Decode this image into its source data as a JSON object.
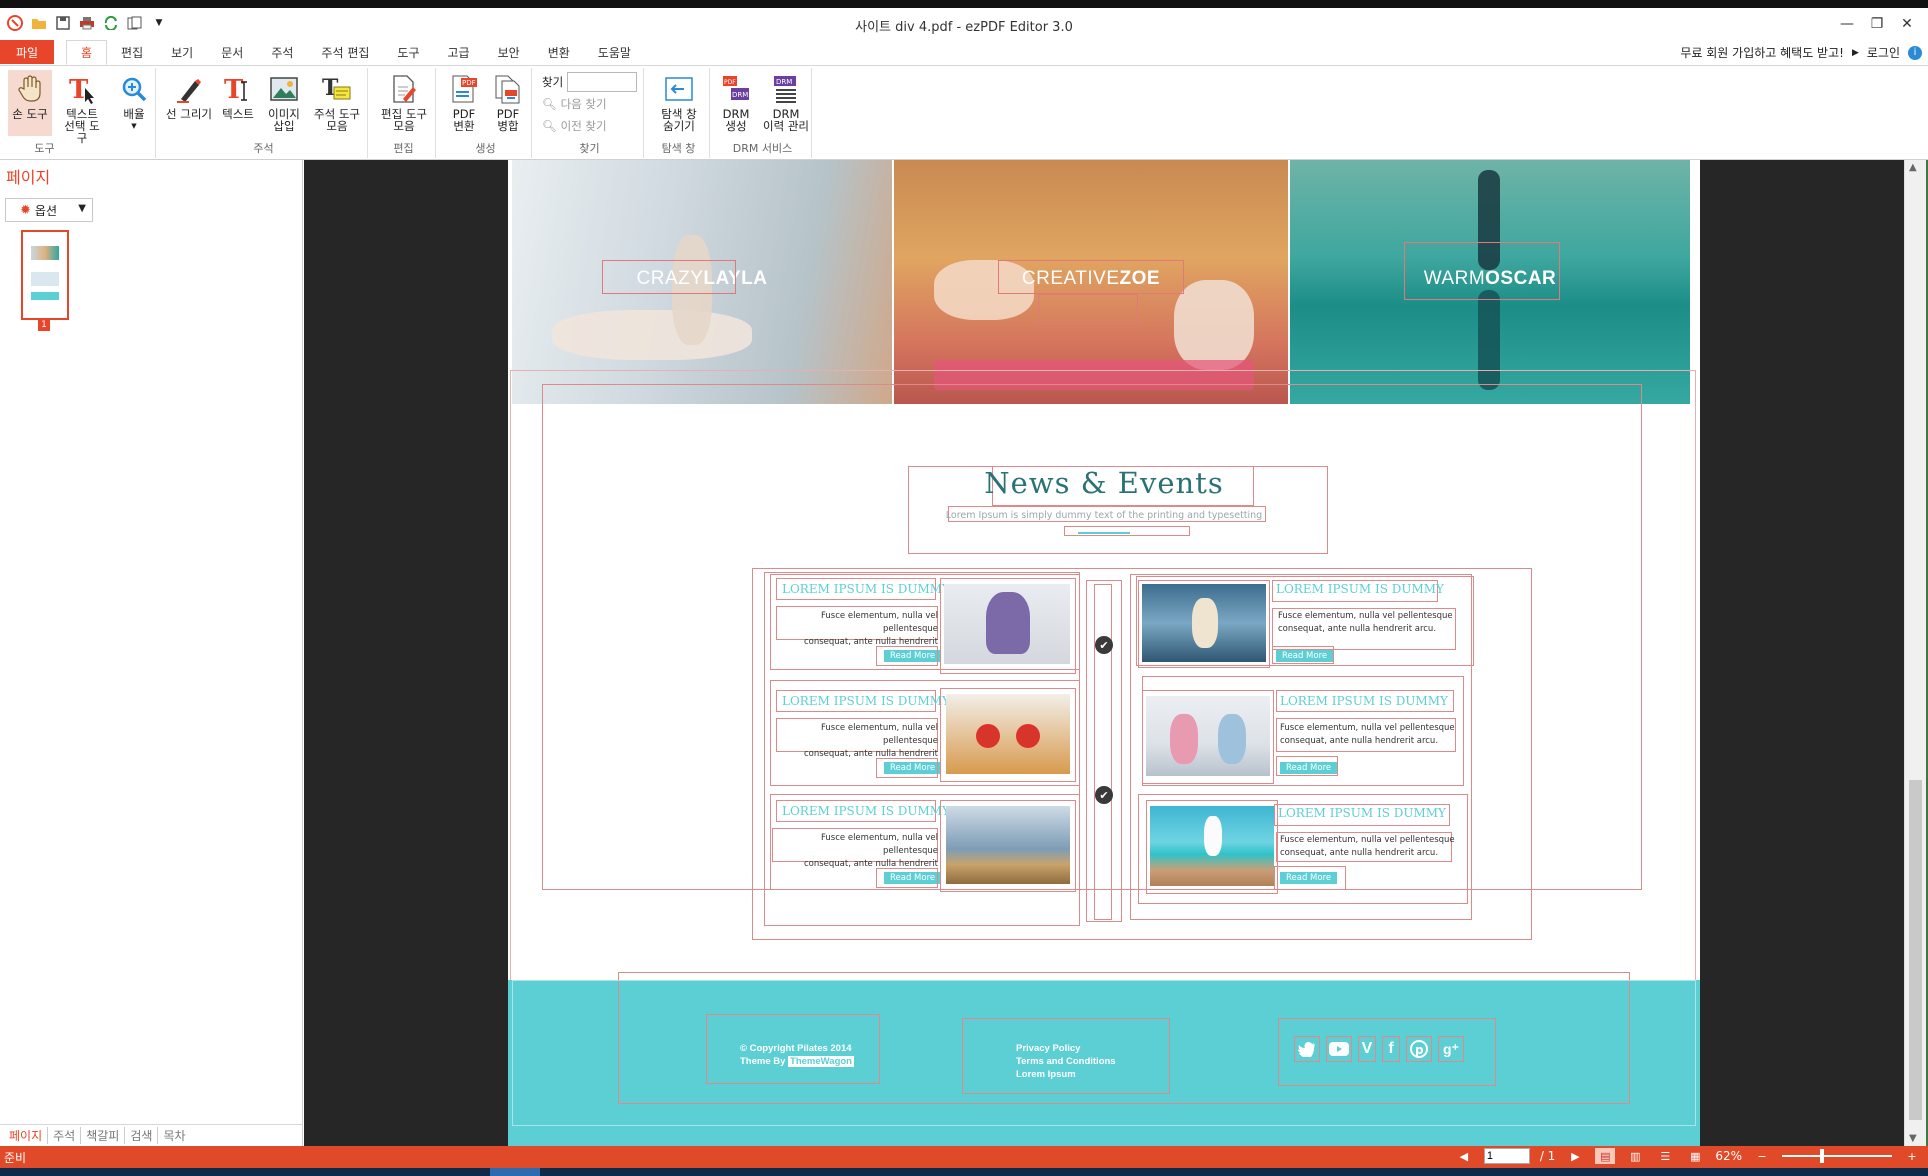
{
  "window": {
    "title": "사이트 div 4.pdf - ezPDF Editor 3.0"
  },
  "menu": {
    "file": "파일",
    "tabs": [
      "홈",
      "편집",
      "보기",
      "문서",
      "주석",
      "주석 편집",
      "도구",
      "고급",
      "보안",
      "변환",
      "도움말"
    ],
    "promo": "무료 회원 가입하고 혜택도 받고!",
    "login": "로그인"
  },
  "ribbon": {
    "hand_tool": "손 도구",
    "text_select_1": "텍스트",
    "text_select_2": "선택 도구",
    "zoom_1": "배율",
    "group_tools": "도구",
    "draw_line": "선 그리기",
    "text": "텍스트",
    "image_1": "이미지",
    "image_2": "삽입",
    "annot_1": "주석 도구",
    "annot_2": "모음",
    "group_annot": "주석",
    "edit_1": "편집 도구",
    "edit_2": "모음",
    "group_edit": "편집",
    "pdf_convert_1": "PDF",
    "pdf_convert_2": "변환",
    "pdf_merge_1": "PDF",
    "pdf_merge_2": "병합",
    "group_create": "생성",
    "find_label": "찾기",
    "find_next": "다음 찾기",
    "find_prev": "이전 찾기",
    "group_find": "찾기",
    "nav_1": "탐색 창",
    "nav_2": "숨기기",
    "group_nav": "탐색 창",
    "drm_create_1": "DRM",
    "drm_create_2": "생성",
    "drm_history_1": "DRM",
    "drm_history_2": "이력 관리",
    "group_drm": "DRM 서비스"
  },
  "left_panel": {
    "title": "페이지",
    "options": "옵션",
    "page_number": "1",
    "tabs": [
      "페이지",
      "주석",
      "책갈피",
      "검색",
      "목차"
    ]
  },
  "document": {
    "hero": [
      {
        "light": "CRAZY",
        "bold": "LAYLA"
      },
      {
        "light": "CREATIVE",
        "bold": "ZOE"
      },
      {
        "light": "WARM",
        "bold": "OSCAR"
      }
    ],
    "news_title": "News & Events",
    "news_subtitle": "Lorem Ipsum is simply dummy text of the printing and typesetting",
    "card_title": "LOREM IPSUM IS DUMMY",
    "card_text_1": "Fusce elementum, nulla vel pellentesque",
    "card_text_2": "consequat, ante nulla hendrerit arcu.",
    "read_more": "Read More",
    "footer": {
      "copyright": "© Copyright Pilates 2014",
      "theme_by": "Theme By",
      "theme_name": "ThemeWagon",
      "privacy": "Privacy Policy",
      "terms": "Terms and Conditions",
      "lorem": "Lorem Ipsum"
    }
  },
  "status": {
    "ready": "준비",
    "page_value": "1",
    "page_total": "/ 1",
    "zoom": "62%"
  },
  "colors": {
    "accent": "#e8462a",
    "teal": "#5ccfd5",
    "title_teal": "#2a7276"
  }
}
